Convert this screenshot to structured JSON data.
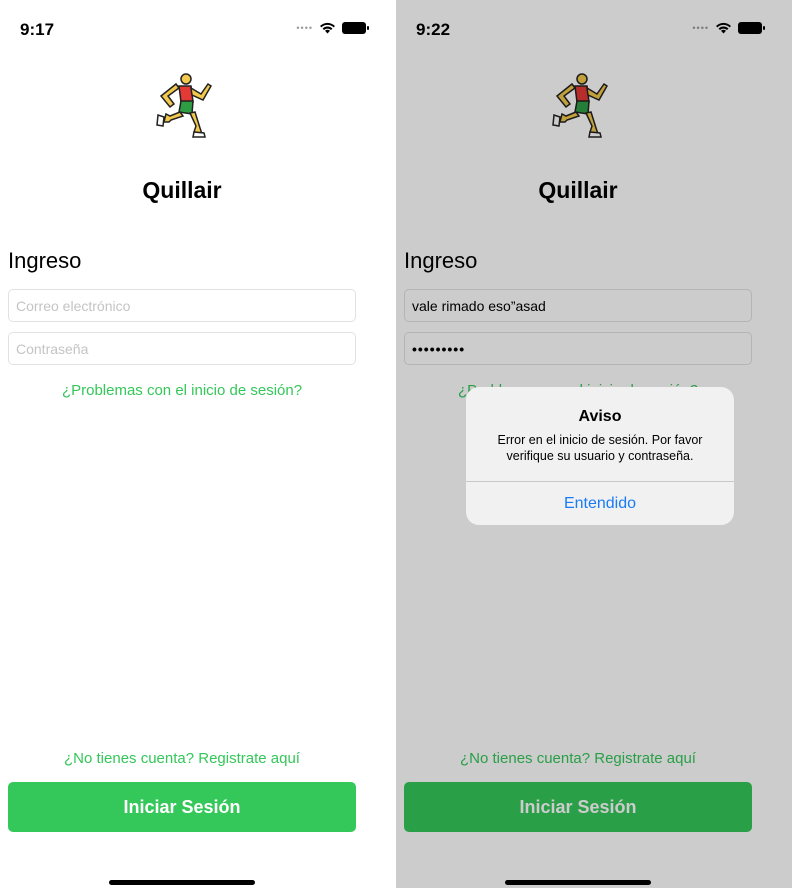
{
  "colors": {
    "accent": "#34c759",
    "link_blue": "#1a7cf5"
  },
  "screens": [
    {
      "status_time": "9:17",
      "app_title": "Quillair",
      "section_title": "Ingreso",
      "email": {
        "placeholder": "Correo electrónico",
        "value": ""
      },
      "password": {
        "placeholder": "Contraseña",
        "value": ""
      },
      "forgot_link": "¿Problemas con el inicio de sesión?",
      "register_link": "¿No tienes cuenta? Registrate aquí",
      "login_button": "Iniciar Sesión"
    },
    {
      "status_time": "9:22",
      "app_title": "Quillair",
      "section_title": "Ingreso",
      "email": {
        "placeholder": "Correo electrónico",
        "value": "vale rimado eso”asad"
      },
      "password": {
        "placeholder": "Contraseña",
        "masked": "•••••••••"
      },
      "forgot_link": "¿Problemas con el inicio de sesión?",
      "register_link": "¿No tienes cuenta? Registrate aquí",
      "login_button": "Iniciar Sesión",
      "alert": {
        "title": "Aviso",
        "message": "Error en el inicio de sesión. Por favor verifique su usuario y contraseña.",
        "button": "Entendido"
      }
    }
  ],
  "icons": {
    "logo": "running-man-icon",
    "wifi": "wifi-icon",
    "battery": "battery-icon",
    "signal": "signal-icon"
  }
}
